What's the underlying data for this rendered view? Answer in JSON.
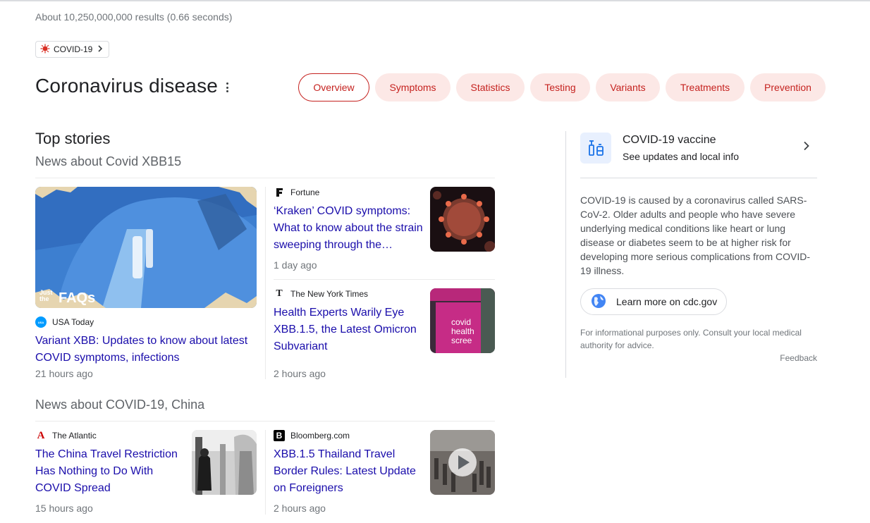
{
  "result_stats": "About 10,250,000,000 results (0.66 seconds)",
  "chip": {
    "label": "COVID-19"
  },
  "title": "Coronavirus disease",
  "tabs": [
    "Overview",
    "Symptoms",
    "Statistics",
    "Testing",
    "Variants",
    "Treatments",
    "Prevention"
  ],
  "top_stories": {
    "heading": "Top stories",
    "section1": {
      "subheading": "News about Covid XBB15",
      "big_image_overlay": {
        "line1": "Just",
        "line2": "the",
        "line3": "FAQs"
      },
      "lead": {
        "source": "USA Today",
        "headline": "Variant XBB: Updates to know about latest COVID symptoms, infections",
        "time": "21 hours ago"
      },
      "story1": {
        "source": "Fortune",
        "headline": "‘Kraken’ COVID symptoms: What to know about the strain sweeping through the…",
        "time": "1 day ago"
      },
      "story2": {
        "source": "The New York Times",
        "headline": "Health Experts Warily Eye XBB.1.5, the Latest Omicron Subvariant",
        "time": "2 hours ago",
        "thumb_text": "covid health scree"
      }
    },
    "section2": {
      "subheading": "News about COVID-19, China",
      "story1": {
        "source": "The Atlantic",
        "headline": "The China Travel Restriction Has Nothing to Do With COVID Spread",
        "time": "15 hours ago"
      },
      "story2": {
        "source": "Bloomberg.com",
        "headline": "XBB.1.5 Thailand Travel Border Rules: Latest Update on Foreigners",
        "time": "2 hours ago"
      }
    }
  },
  "right_panel": {
    "vaccine_title": "COVID-19 vaccine",
    "vaccine_sub": "See updates and local info",
    "description": "COVID-19 is caused by a coronavirus called SARS-CoV-2. Older adults and people who have severe underlying medical conditions like heart or lung disease or diabetes seem to be at higher risk for developing more serious complications from COVID-19 illness.",
    "learn_more": "Learn more on cdc.gov",
    "disclaimer": "For informational purposes only. Consult your local medical authority for advice.",
    "feedback": "Feedback"
  },
  "colors": {
    "accent": "#c5221f",
    "tab_bg": "#fce8e6",
    "link": "#1a0dab",
    "meta": "#70757a"
  },
  "icons": [
    "virus-icon",
    "chevron-right-icon",
    "more-vert-icon",
    "vaccine-icon",
    "globe-icon",
    "play-icon"
  ]
}
